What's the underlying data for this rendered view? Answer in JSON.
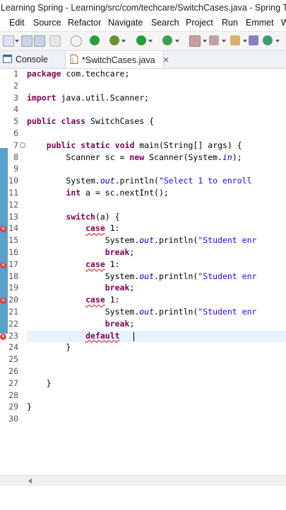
{
  "window": {
    "title": "Learning Spring - Learning/src/com/techcare/SwitchCases.java - Spring Tool S"
  },
  "menu": [
    "Edit",
    "Source",
    "Refactor",
    "Navigate",
    "Search",
    "Project",
    "Run",
    "Emmet",
    "W"
  ],
  "toolbar": {
    "icons": [
      "new-file-icon",
      "save-icon",
      "save-all-icon",
      "link-icon",
      "stop-icon",
      "debug-icon",
      "run-icon",
      "run-as-icon",
      "tools-icon",
      "package-icon",
      "terminal-icon",
      "refresh-icon"
    ]
  },
  "tabs": [
    {
      "label": "Console",
      "icon": "console-icon",
      "active": false
    },
    {
      "label": "*SwitchCases.java",
      "icon": "java-file-icon",
      "active": true,
      "close": "×"
    }
  ],
  "editor": {
    "line_numbers": [
      "1",
      "2",
      "3",
      "4",
      "5",
      "6",
      "7",
      "8",
      "9",
      "10",
      "11",
      "12",
      "13",
      "14",
      "15",
      "16",
      "17",
      "18",
      "19",
      "20",
      "21",
      "22",
      "23",
      "24",
      "25",
      "26",
      "27",
      "28",
      "29",
      "30"
    ],
    "lines": [
      "package com.techcare;",
      "",
      "import java.util.Scanner;",
      "",
      "public class SwitchCases {",
      "",
      "    public static void main(String[] args) {",
      "        Scanner sc = new Scanner(System.in);",
      "",
      "        System.out.println(\"Select 1 to enroll",
      "        int a = sc.nextInt();",
      "",
      "        switch(a) {",
      "            case 1:",
      "                System.out.println(\"Student enr",
      "                break;",
      "            case 1:",
      "                System.out.println(\"Student enr",
      "                break;",
      "            case 1:",
      "                System.out.println(\"Student enr",
      "                break;",
      "            default",
      "        }",
      "",
      "",
      "    }",
      "",
      "}",
      ""
    ],
    "error_icon_glyph": "×",
    "error_lines": [
      "14",
      "17",
      "20",
      "23"
    ],
    "current_line": "23"
  },
  "colors": {
    "keyword": "#7f0055",
    "string": "#2a00ff",
    "field": "#0000c0",
    "error": "#e03030",
    "ruler": "#5aa0c8"
  }
}
